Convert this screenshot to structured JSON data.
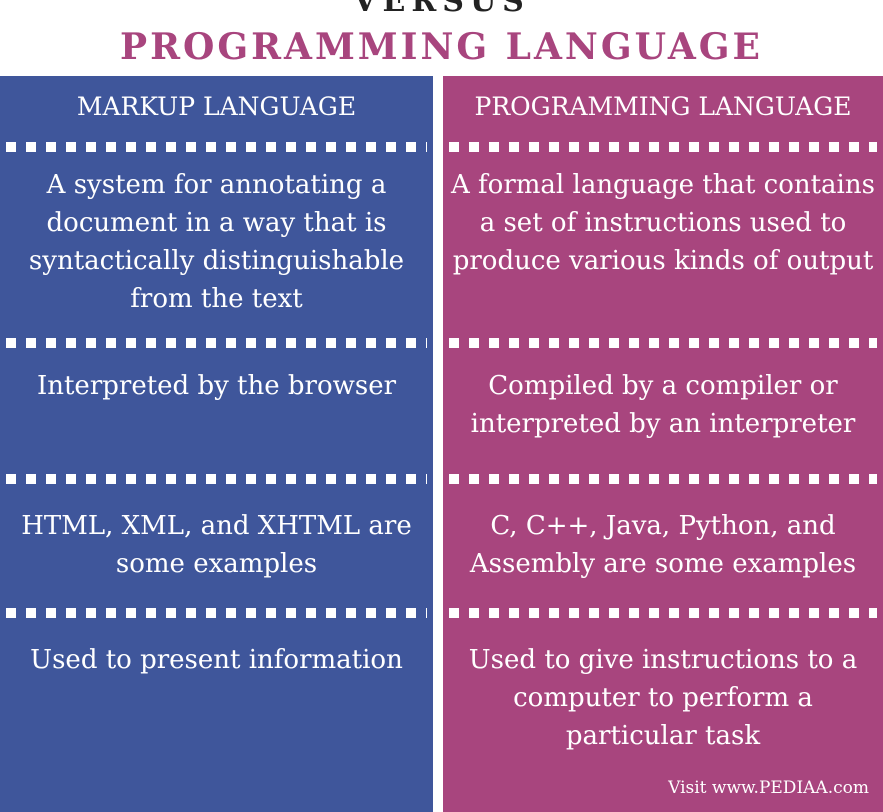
{
  "header": {
    "versus_label": "VERSUS",
    "title": "PROGRAMMING LANGUAGE"
  },
  "columns": [
    {
      "heading": "MARKUP LANGUAGE",
      "rows": [
        "A system for annotating a document in a way that is syntactically distinguishable from the text",
        "Interpreted by the browser",
        "HTML, XML, and XHTML are some examples",
        "Used to present information"
      ]
    },
    {
      "heading": "PROGRAMMING LANGUAGE",
      "rows": [
        "A formal language that contains a set of instructions used to produce various kinds of output",
        "Compiled by a compiler or interpreted by an interpreter",
        "C, C++, Java, Python, and Assembly are some examples",
        "Used to give instructions to a computer to perform a particular task"
      ]
    }
  ],
  "footer": {
    "credit": "Visit www.PEDIAA.com"
  },
  "colors": {
    "markup_column": "#3f569b",
    "programming_column": "#a8457e",
    "title_text": "#a8457e"
  }
}
